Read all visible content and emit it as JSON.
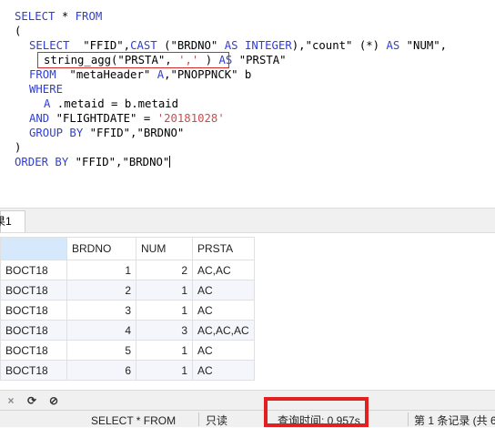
{
  "sql": {
    "line1": [
      "SELECT",
      " * ",
      "FROM"
    ],
    "line2": "(",
    "line3": {
      "kw1": "SELECT",
      "t1": "  \"FFID\",",
      "kw2": "CAST",
      "t2": " (\"BRDNO\" ",
      "kw3": "AS INTEGER",
      "t3": "),\"count\" (*) ",
      "kw4": "AS",
      "t4": " \"NUM\","
    },
    "line4": {
      "t1": "string_agg(\"PRSTA\", ",
      "s1": "','",
      "t2": " )",
      "kw1": " AS",
      "t3": " \"PRSTA\""
    },
    "line5": {
      "kw1": "FROM",
      "t1": "  \"metaHeader\" ",
      "kw2": "A",
      "t2": ",\"PNOPPNCK\" b"
    },
    "line6": "WHERE",
    "line7": {
      "kw1": "A",
      "t1": " .metaid = b.metaid"
    },
    "line8": {
      "kw1": "AND",
      "t1": " \"FLIGHTDATE\" = ",
      "s1": "'20181028'"
    },
    "line9": {
      "kw1": "GROUP BY",
      "t1": " \"FFID\",\"BRDNO\""
    },
    "line10": ")",
    "line11": {
      "kw1": "ORDER BY",
      "t1": " \"FFID\",\"BRDNO\""
    }
  },
  "result_tab": {
    "label": "果1"
  },
  "grid": {
    "columns": [
      "",
      "BRDNO",
      "NUM",
      "PRSTA"
    ],
    "rows": [
      {
        "ffid": "BOCT18",
        "brdno": "1",
        "num": "2",
        "prsta": "AC,AC"
      },
      {
        "ffid": "BOCT18",
        "brdno": "2",
        "num": "1",
        "prsta": "AC"
      },
      {
        "ffid": "BOCT18",
        "brdno": "3",
        "num": "1",
        "prsta": "AC"
      },
      {
        "ffid": "BOCT18",
        "brdno": "4",
        "num": "3",
        "prsta": "AC,AC,AC"
      },
      {
        "ffid": "BOCT18",
        "brdno": "5",
        "num": "1",
        "prsta": "AC"
      },
      {
        "ffid": "BOCT18",
        "brdno": "6",
        "num": "1",
        "prsta": "AC"
      }
    ]
  },
  "toolbar": {
    "icons": [
      "close-icon",
      "refresh-icon",
      "stop-icon"
    ],
    "glyphs": [
      "×",
      "⟳",
      "⊘"
    ]
  },
  "status": {
    "query": "SELECT * FROM",
    "readonly": "只读",
    "query_time": "查询时间: 0.957s",
    "record": "第 1 条记录 (共 6"
  }
}
